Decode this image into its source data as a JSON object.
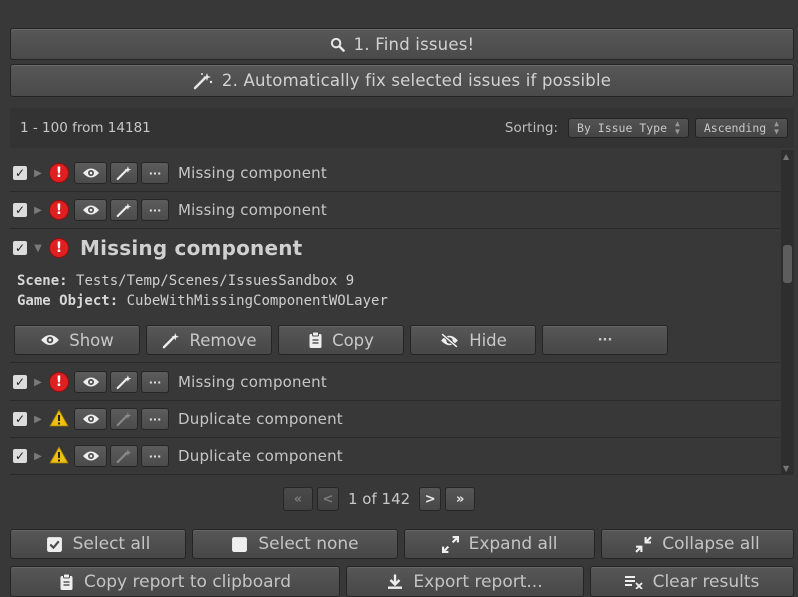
{
  "top": {
    "find_label": "1. Find issues!",
    "fix_label": "2. Automatically fix selected issues if possible"
  },
  "toolbar": {
    "count_text": "1 - 100 from 14181",
    "sorting_label": "Sorting:",
    "sort_by": "By Issue Type",
    "sort_order": "Ascending"
  },
  "issues": [
    {
      "label": "Missing component",
      "severity": "error",
      "checked": true
    },
    {
      "label": "Missing component",
      "severity": "error",
      "checked": true
    },
    {
      "label": "Missing component",
      "severity": "error",
      "checked": true,
      "expanded": true
    },
    {
      "label": "Missing component",
      "severity": "error",
      "checked": true
    },
    {
      "label": "Duplicate component",
      "severity": "warning",
      "checked": true
    },
    {
      "label": "Duplicate component",
      "severity": "warning",
      "checked": true
    }
  ],
  "expanded_issue": {
    "scene_key": "Scene:",
    "scene_value": "Tests/Temp/Scenes/IssuesSandbox 9",
    "object_key": "Game Object:",
    "object_value": "CubeWithMissingComponentWOLayer",
    "actions": {
      "show": "Show",
      "remove": "Remove",
      "copy": "Copy",
      "hide": "Hide",
      "more": "···"
    }
  },
  "pager": {
    "text": "1 of 142",
    "first": "«",
    "prev": "<",
    "next": ">",
    "last": "»"
  },
  "bottom": {
    "select_all": "Select all",
    "select_none": "Select none",
    "expand_all": "Expand all",
    "collapse_all": "Collapse all",
    "copy_report": "Copy report to clipboard",
    "export_report": "Export report...",
    "clear_results": "Clear results"
  },
  "colors": {
    "background": "#383838",
    "error": "#e02020",
    "warning": "#f0c010"
  }
}
